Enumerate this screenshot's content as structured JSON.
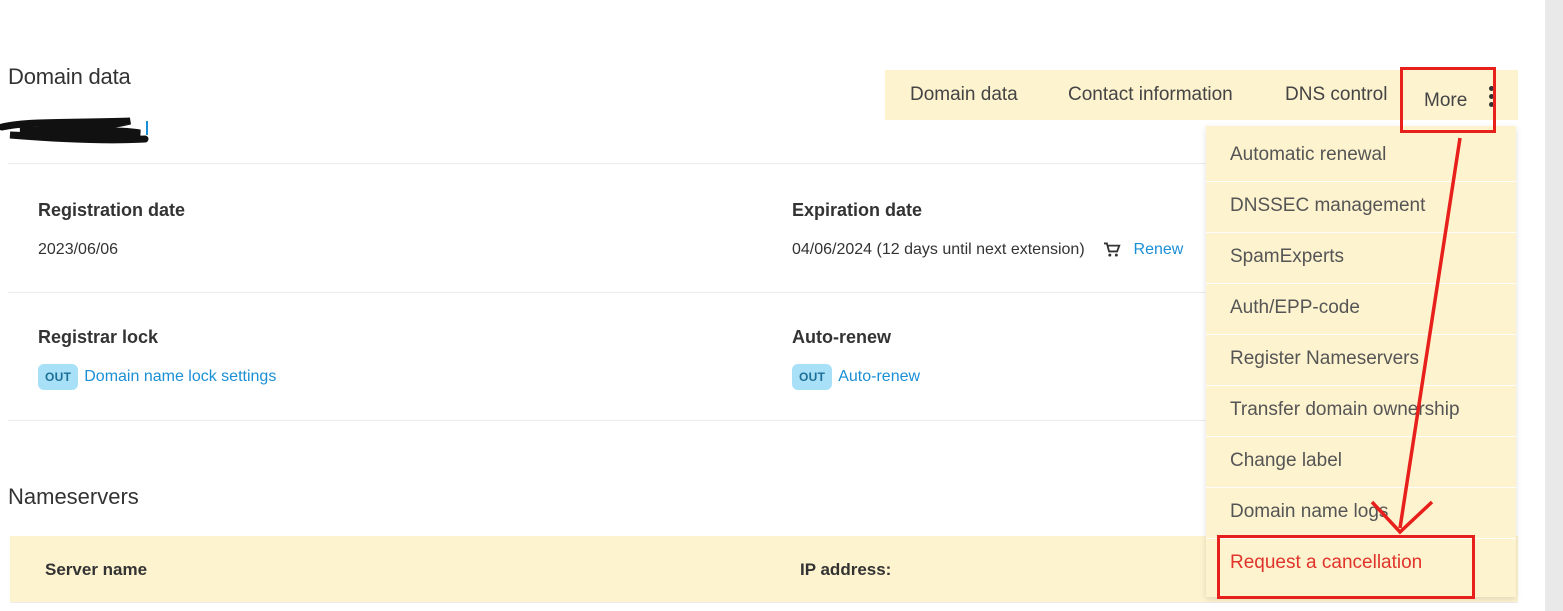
{
  "page": {
    "title": "Domain data"
  },
  "tabs": [
    {
      "label": "Domain data"
    },
    {
      "label": "Contact information"
    },
    {
      "label": "DNS control"
    },
    {
      "label": "More"
    }
  ],
  "details": {
    "registration": {
      "label": "Registration date",
      "value": "2023/06/06"
    },
    "expiration": {
      "label": "Expiration date",
      "value": "04/06/2024 (12 days until next extension)",
      "renew_link": "Renew"
    },
    "registrar_lock": {
      "label": "Registrar lock",
      "badge": "OUT",
      "link": "Domain name lock settings"
    },
    "auto_renew": {
      "label": "Auto-renew",
      "badge": "OUT",
      "link": "Auto-renew"
    }
  },
  "nameservers": {
    "title": "Nameservers",
    "columns": [
      "Server name",
      "IP address:"
    ]
  },
  "more_menu": {
    "items": [
      "Automatic renewal",
      "DNSSEC management",
      "SpamExperts",
      "Auth/EPP-code",
      "Register Nameservers",
      "Transfer domain ownership",
      "Change label",
      "Domain name logs",
      "Request a cancellation"
    ]
  },
  "colors": {
    "accent_bg": "#fdf3cf",
    "link": "#1a8fd6",
    "badge_bg": "#a8e0f7",
    "danger": "#e0332b",
    "annotation": "#e8201b"
  },
  "icons": {
    "cart": "cart-icon",
    "more": "more-vertical-icon"
  }
}
